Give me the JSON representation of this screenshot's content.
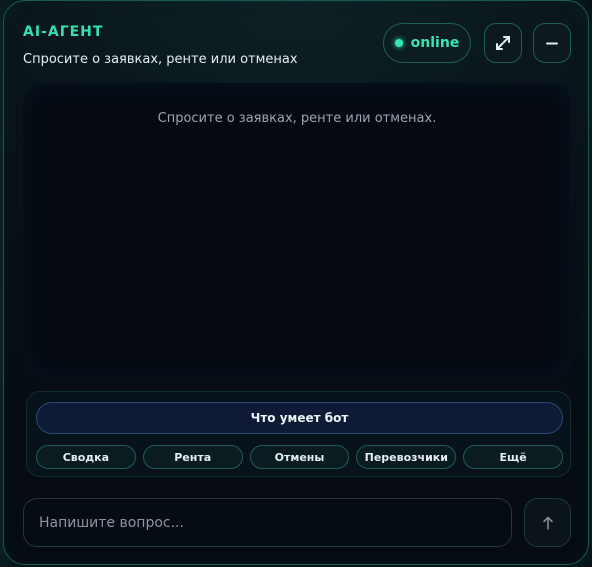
{
  "header": {
    "title": "AI-АГЕНТ",
    "subtitle": "Спросите о заявках, ренте или отменах",
    "status": "online"
  },
  "chat": {
    "empty_hint": "Спросите о заявках, ренте или отменах."
  },
  "actions": {
    "primary_label": "Что умеет бот",
    "quick": [
      {
        "label": "Сводка"
      },
      {
        "label": "Рента"
      },
      {
        "label": "Отмены"
      },
      {
        "label": "Перевозчики"
      },
      {
        "label": "Ещё"
      }
    ]
  },
  "composer": {
    "placeholder": "Напишите вопрос...",
    "send_icon": "arrow-up-icon"
  },
  "colors": {
    "accent": "#33e0b0",
    "status": "#35e6b4",
    "background": "#060c12"
  }
}
